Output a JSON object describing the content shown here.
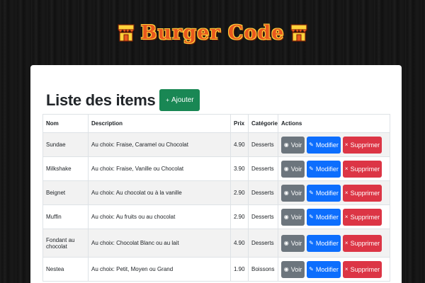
{
  "header": {
    "brand": "Burger Code",
    "icon_left": "shop-icon",
    "icon_right": "shop-icon"
  },
  "page": {
    "title": "Liste des items",
    "add_button": "Ajouter",
    "add_icon": "plus-icon"
  },
  "table": {
    "columns": [
      "Nom",
      "Description",
      "Prix",
      "Catégorie",
      "Actions"
    ],
    "rows": [
      {
        "nom": "Sundae",
        "description": "Au choix: Fraise, Caramel ou Chocolat",
        "prix": "4.90",
        "categorie": "Desserts"
      },
      {
        "nom": "Milkshake",
        "description": "Au choix: Fraise, Vanille ou Chocolat",
        "prix": "3.90",
        "categorie": "Desserts"
      },
      {
        "nom": "Beignet",
        "description": "Au choix: Au chocolat ou à la vanille",
        "prix": "2.90",
        "categorie": "Desserts"
      },
      {
        "nom": "Muffin",
        "description": "Au choix: Au fruits ou au chocolat",
        "prix": "2.90",
        "categorie": "Desserts"
      },
      {
        "nom": "Fondant au chocolat",
        "description": "Au choix: Chocolat Blanc ou au lait",
        "prix": "4.90",
        "categorie": "Desserts"
      },
      {
        "nom": "Nestea",
        "description": "Au choix: Petit, Moyen ou Grand",
        "prix": "1.90",
        "categorie": "Boissons"
      }
    ],
    "actions": {
      "view": "Voir",
      "edit": "Modifier",
      "delete": "Supprimer"
    }
  }
}
